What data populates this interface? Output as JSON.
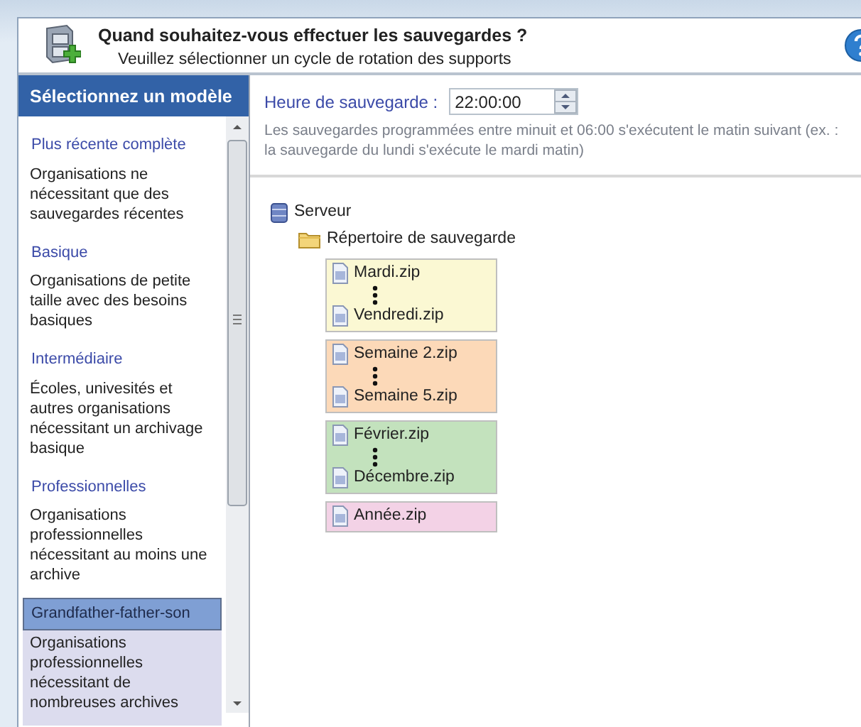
{
  "header": {
    "title": "Quand souhaitez-vous effectuer les sauvegardes ?",
    "subtitle": "Veuillez sélectionner un cycle de rotation des supports"
  },
  "models_panel": {
    "title": "Sélectionnez un modèle",
    "items": [
      {
        "title": "Plus récente complète",
        "description": "Organisations ne nécessitant que des sauvegardes récentes",
        "selected": false
      },
      {
        "title": "Basique",
        "description": "Organisations de petite taille avec des besoins basiques",
        "selected": false
      },
      {
        "title": "Intermédiaire",
        "description": "Écoles, univesités et autres organisations nécessitant un archivage basique",
        "selected": false
      },
      {
        "title": "Professionnelles",
        "description": "Organisations professionnelles nécessitant au moins une archive",
        "selected": false
      },
      {
        "title": "Grandfather-father-son",
        "description": "Organisations professionnelles nécessitant de nombreuses archives",
        "selected": true
      }
    ]
  },
  "schedule": {
    "label": "Heure de sauvegarde :",
    "time": "22:00:00",
    "note": "Les sauvegardes programmées entre minuit et 06:00 s'exécutent le matin suivant (ex. : la sauvegarde du lundi s'exécute le mardi matin)"
  },
  "tree": {
    "server": "Serveur",
    "folder": "Répertoire de sauvegarde",
    "groups": [
      {
        "color": "#fbf8d3",
        "files": [
          "Mardi.zip",
          "Vendredi.zip"
        ]
      },
      {
        "color": "#fcd9b8",
        "files": [
          "Semaine 2.zip",
          "Semaine 5.zip"
        ]
      },
      {
        "color": "#c3e2bd",
        "files": [
          "Février.zip",
          "Décembre.zip"
        ]
      },
      {
        "color": "#f3d2e6",
        "files": [
          "Année.zip"
        ]
      }
    ]
  }
}
